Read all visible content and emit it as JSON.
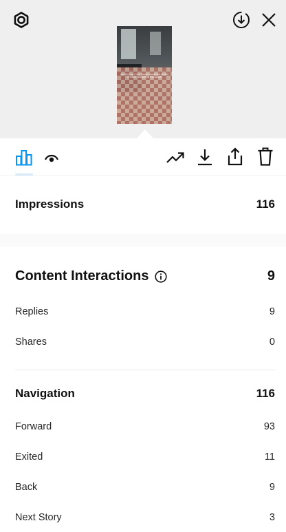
{
  "header": {
    "settings_icon": "gear-icon",
    "download_icon": "circle-download-icon",
    "close_icon": "close-icon",
    "thumbnail_caption": "got the rug I had always dreamed of and it really completed the space"
  },
  "toolbar": {
    "tabs": [
      {
        "icon": "bar-chart-icon",
        "active": true,
        "color": "#0095f6"
      },
      {
        "icon": "eye-icon",
        "active": false
      }
    ],
    "actions": [
      "trending-up-icon",
      "download-icon",
      "share-icon",
      "trash-icon"
    ]
  },
  "impressions": {
    "label": "Impressions",
    "value": "116"
  },
  "content_interactions": {
    "label": "Content Interactions",
    "value": "9",
    "rows": [
      {
        "label": "Replies",
        "value": "9"
      },
      {
        "label": "Shares",
        "value": "0"
      }
    ]
  },
  "navigation": {
    "label": "Navigation",
    "value": "116",
    "rows": [
      {
        "label": "Forward",
        "value": "93"
      },
      {
        "label": "Exited",
        "value": "11"
      },
      {
        "label": "Back",
        "value": "9"
      },
      {
        "label": "Next Story",
        "value": "3"
      }
    ]
  },
  "colors": {
    "accent": "#0095f6",
    "header_bg": "#efefef"
  }
}
